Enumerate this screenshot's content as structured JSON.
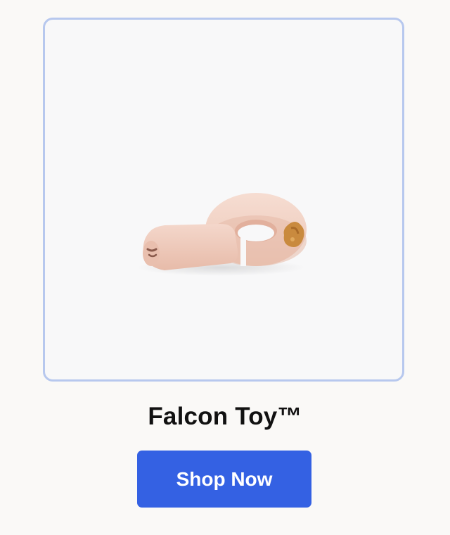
{
  "product": {
    "name": "Falcon Toy™",
    "image_alt": "falcon-toy-image"
  },
  "cta": {
    "label": "Shop Now"
  },
  "colors": {
    "background": "#faf9f7",
    "card_border": "#b7c8ee",
    "card_background": "#f8f8f9",
    "button_background": "#3461e3",
    "button_text": "#ffffff",
    "toy_color": "#f2d2c5",
    "treat_color": "#c98a3e"
  }
}
